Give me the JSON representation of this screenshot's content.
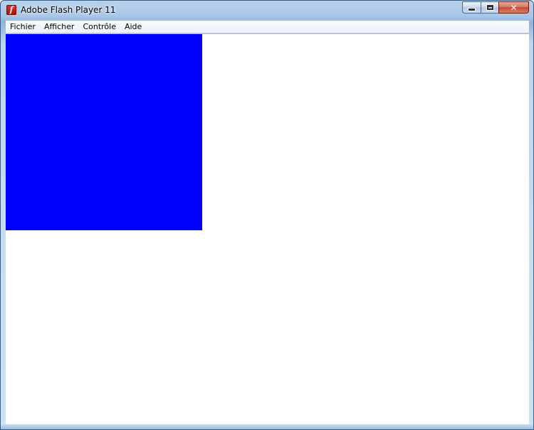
{
  "window": {
    "title": "Adobe Flash Player 11",
    "app_icon": "flash-player-icon",
    "app_icon_glyph": "f",
    "controls": {
      "minimize_icon": "minimize-icon",
      "maximize_icon": "maximize-icon",
      "close_icon": "close-icon",
      "close_glyph": "✕"
    }
  },
  "menubar": {
    "items": [
      "Fichier",
      "Afficher",
      "Contrôle",
      "Aide"
    ]
  },
  "stage": {
    "background": "#ffffff",
    "shape_color": "#0000ff"
  }
}
